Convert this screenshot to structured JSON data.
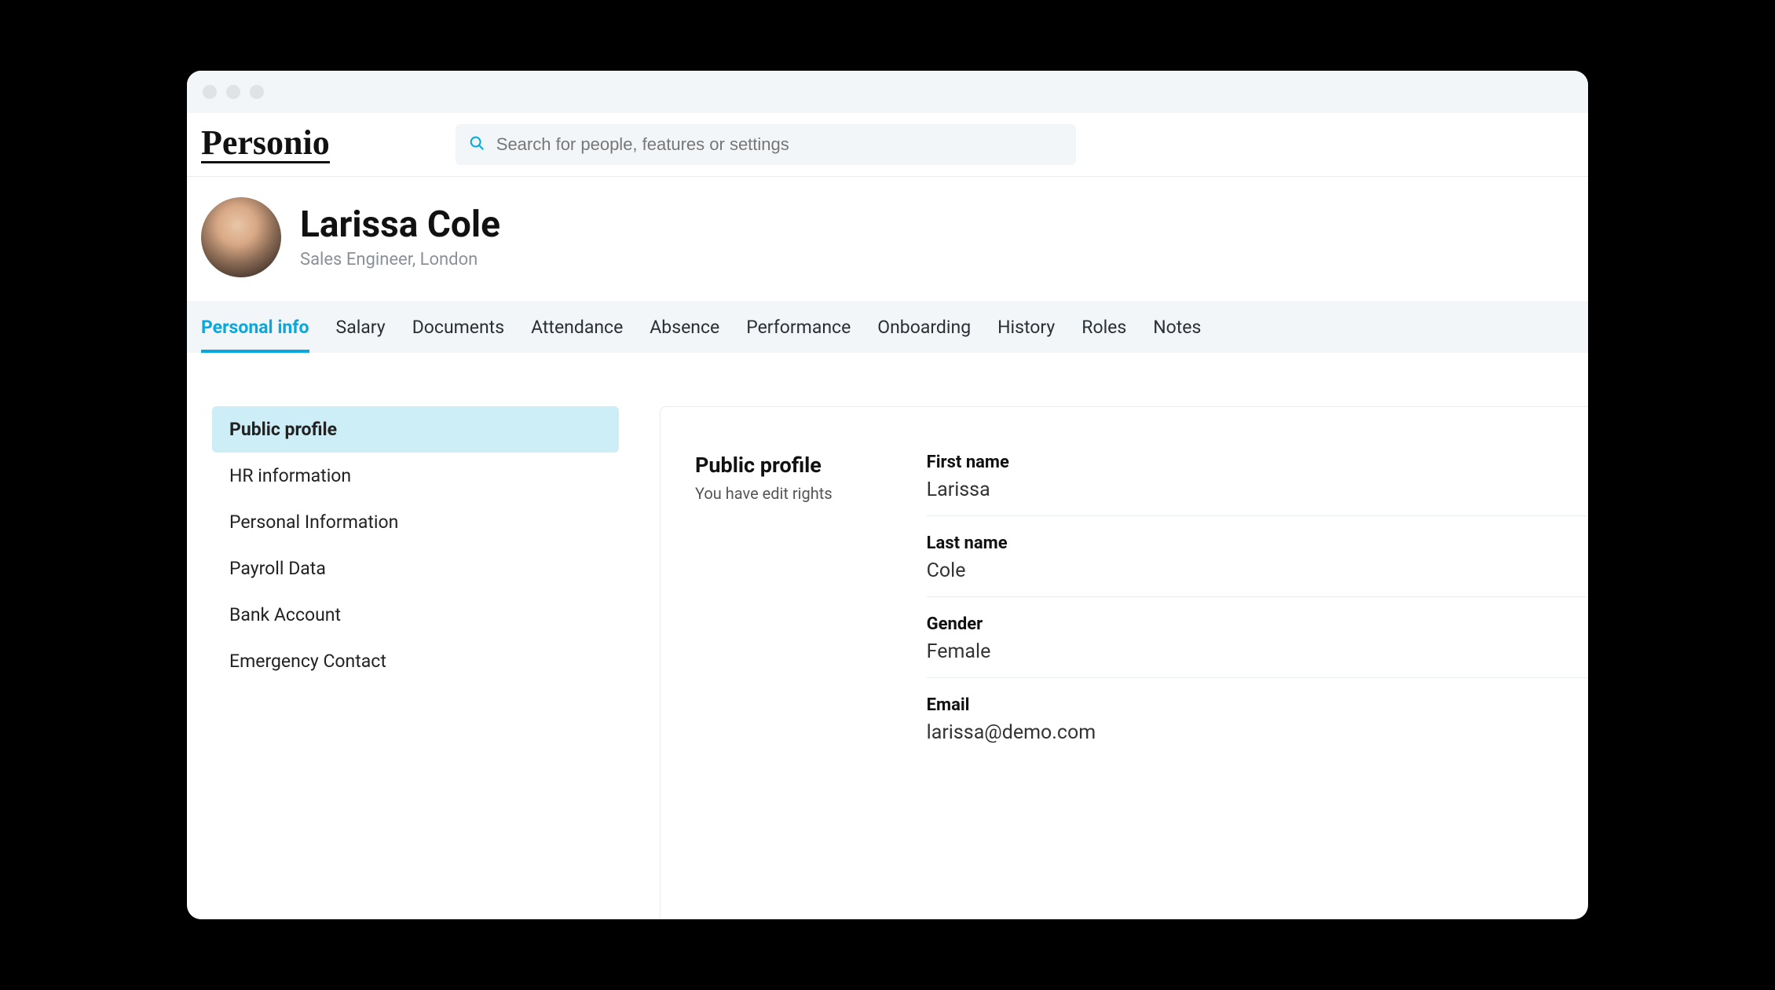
{
  "brand": "Personio",
  "search": {
    "placeholder": "Search for people, features or settings"
  },
  "profile": {
    "name": "Larissa Cole",
    "subtitle": "Sales Engineer, London"
  },
  "tabs": [
    {
      "label": "Personal info",
      "active": true
    },
    {
      "label": "Salary"
    },
    {
      "label": "Documents"
    },
    {
      "label": "Attendance"
    },
    {
      "label": "Absence"
    },
    {
      "label": "Performance"
    },
    {
      "label": "Onboarding"
    },
    {
      "label": "History"
    },
    {
      "label": "Roles"
    },
    {
      "label": "Notes"
    }
  ],
  "sidebar": {
    "items": [
      {
        "label": "Public profile",
        "active": true
      },
      {
        "label": "HR information"
      },
      {
        "label": "Personal Information"
      },
      {
        "label": "Payroll Data"
      },
      {
        "label": "Bank Account"
      },
      {
        "label": "Emergency Contact"
      }
    ]
  },
  "section": {
    "title": "Public profile",
    "subtitle": "You have edit rights"
  },
  "fields": [
    {
      "label": "First name",
      "value": "Larissa"
    },
    {
      "label": "Last name",
      "value": "Cole"
    },
    {
      "label": "Gender",
      "value": "Female"
    },
    {
      "label": "Email",
      "value": "larissa@demo.com"
    }
  ],
  "colors": {
    "accent": "#06a8dd",
    "activeBg": "#cdeef6"
  }
}
